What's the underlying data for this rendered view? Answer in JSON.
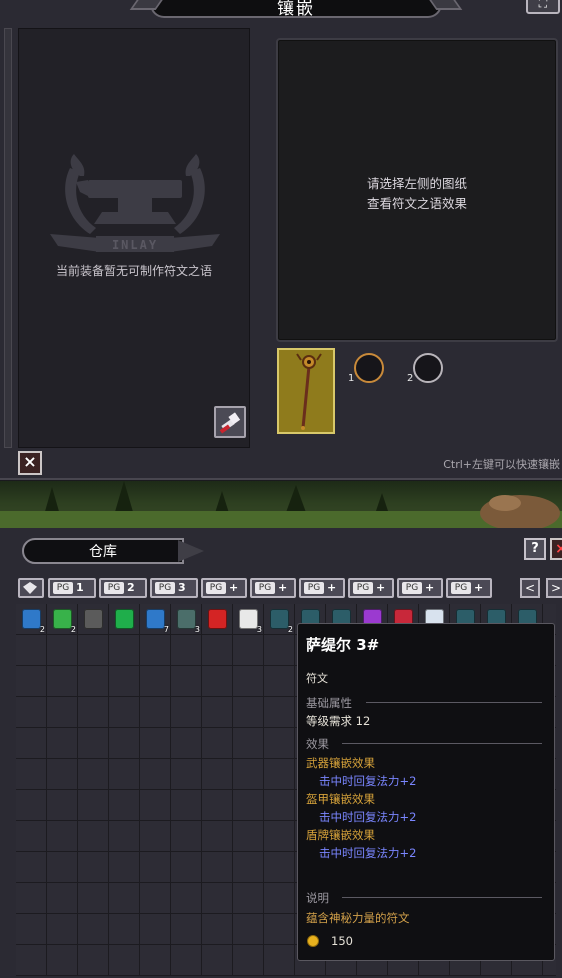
{
  "inlay": {
    "title": "镶嵌",
    "empty_message": "当前装备暂无可制作符文之语",
    "emblem_text": "INLAY",
    "preview_message_line1": "请选择左侧的图纸",
    "preview_message_line2": "查看符文之语效果",
    "socket_1_label": "1",
    "socket_2_label": "2",
    "hint": "Ctrl+左键可以快速镶嵌",
    "close_icon": "×",
    "expand_icon": "⛶"
  },
  "warehouse": {
    "title": "仓库",
    "help_label": "?",
    "close_label": "×",
    "page_tabs": [
      {
        "label": "1"
      },
      {
        "label": "2"
      },
      {
        "label": "3"
      },
      {
        "label": "+"
      },
      {
        "label": "+"
      },
      {
        "label": "+"
      },
      {
        "label": "+"
      },
      {
        "label": "+"
      },
      {
        "label": "+"
      }
    ],
    "page_tab_icon_text": "PG",
    "nav_prev": "<",
    "nav_next": ">",
    "items": [
      {
        "icon": "blue-pyramid-icon",
        "color": "#2f79c9",
        "qty": "2"
      },
      {
        "icon": "green-herbs-icon",
        "color": "#38b24a",
        "qty": "2"
      },
      {
        "icon": "gray-pyramid-icon",
        "color": "#5b5b5b",
        "qty": ""
      },
      {
        "icon": "green-crystal-icon",
        "color": "#1fae4b",
        "qty": ""
      },
      {
        "icon": "blue-rune-icon",
        "color": "#2f79c9",
        "qty": "7"
      },
      {
        "icon": "gray-rune-icon",
        "color": "#4b6e6a",
        "qty": "3"
      },
      {
        "icon": "red-crystal-icon",
        "color": "#d42424",
        "qty": ""
      },
      {
        "icon": "white-stones-icon",
        "color": "#e8e8e8",
        "qty": "3"
      },
      {
        "icon": "teal-rune-icon",
        "color": "#2c5d68",
        "qty": "2"
      },
      {
        "icon": "teal-rune-icon",
        "color": "#2c5d68",
        "qty": ""
      },
      {
        "icon": "teal-rune-icon",
        "color": "#2c5d68",
        "qty": ""
      },
      {
        "icon": "purple-gems-icon",
        "color": "#9b3ad0",
        "qty": ""
      },
      {
        "icon": "red-gems-icon",
        "color": "#c8283a",
        "qty": ""
      },
      {
        "icon": "white-orb-icon",
        "color": "#d8e2ee",
        "qty": ""
      },
      {
        "icon": "teal-rune-icon",
        "color": "#2c5d68",
        "qty": ""
      },
      {
        "icon": "teal-rune-icon",
        "color": "#2c5d68",
        "qty": ""
      },
      {
        "icon": "teal-rune-icon",
        "color": "#2c5d68",
        "qty": ""
      }
    ]
  },
  "tooltip": {
    "name": "萨缇尔 3#",
    "type": "符文",
    "base_section": "基础属性",
    "level_req": "等级需求 12",
    "effect_section": "效果",
    "weapon_effect": "武器镶嵌效果",
    "weapon_effect_value": "击中时回复法力+2",
    "armor_effect": "盔甲镶嵌效果",
    "armor_effect_value": "击中时回复法力+2",
    "shield_effect": "盾牌镶嵌效果",
    "shield_effect_value": "击中时回复法力+2",
    "desc_section": "说明",
    "description": "蕴含神秘力量的符文",
    "price": "150"
  }
}
